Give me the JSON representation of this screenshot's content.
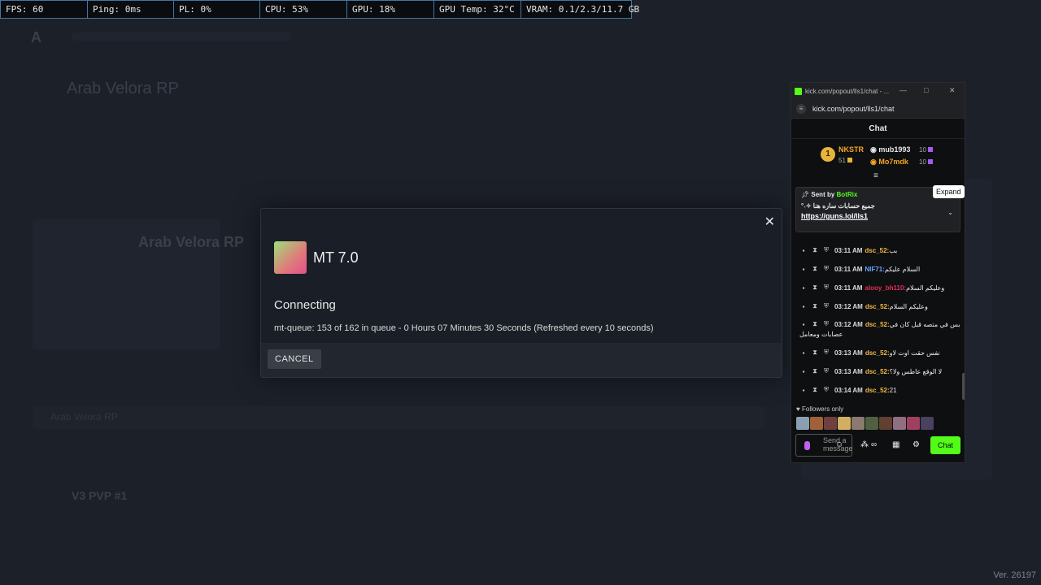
{
  "perf": {
    "fps": "FPS: 60",
    "ping": "Ping: 0ms",
    "pl": "PL: 0%",
    "cpu": "CPU: 53%",
    "gpu": "GPU: 18%",
    "gpu_temp": "GPU Temp: 32°C",
    "vram": "VRAM: 0.1/2.3/11.7 GB"
  },
  "background": {
    "server_name": "Arab Velora RP",
    "server_small": "Arab Velora RP",
    "server_row": "V3 PVP #1",
    "version": "Ver. 26197"
  },
  "modal": {
    "title": "MT 7.0",
    "status": "Connecting",
    "queue_text": "mt-queue: 153 of 162 in queue - 0 Hours 07 Minutes 30 Seconds (Refreshed every 10 seconds)",
    "cancel_label": "CANCEL",
    "close_glyph": "✕"
  },
  "chat": {
    "window_title": "kick.com/popout/lls1/chat - ...",
    "url": "kick.com/popout/lls1/chat",
    "header": "Chat",
    "leaderboard": {
      "first_name": "NKSTR",
      "first_value": "51",
      "first_rank": "1",
      "second_name": "mub1993",
      "second_value": "10",
      "third_name": "Mo7mdk",
      "third_value": "10"
    },
    "pinned": {
      "sent_by": "Sent by",
      "bot": "BotRix",
      "message": "جميع حسابات ساره هنا ✧˖°",
      "link": "https://guns.lol/lls1",
      "expand_tooltip": "Expand"
    },
    "messages": [
      {
        "time": "03:11 AM",
        "user": "dsc_52:",
        "text": "بب",
        "color": "#f2b84b"
      },
      {
        "time": "03:11 AM",
        "user": "NIF71:",
        "text": "السلام عليكم",
        "color": "#6aa6ff"
      },
      {
        "time": "03:11 AM",
        "user": "alooy_bh110:",
        "text": "وعليكم السلام",
        "color": "#e0305a"
      },
      {
        "time": "03:12 AM",
        "user": "dsc_52:",
        "text": "وعليكم السلام",
        "color": "#f2b84b"
      },
      {
        "time": "03:12 AM",
        "user": "dsc_52:",
        "text": "بس في متصه قبل كان في",
        "color": "#f2b84b"
      },
      {
        "time": "03:13 AM",
        "user": "dsc_52:",
        "text": "نفس حقت اوت لاو",
        "color": "#f2b84b"
      },
      {
        "time": "03:13 AM",
        "user": "dsc_52:",
        "text": "لا الوقع عاطس ولا؟",
        "color": "#f2b84b"
      },
      {
        "time": "03:14 AM",
        "user": "dsc_52:",
        "text": "21",
        "color": "#f2b84b"
      }
    ],
    "wrap_line": "عصابات ومعامل",
    "followers_only": "Followers only",
    "input_placeholder": "Send a message",
    "send_label": "Chat",
    "infinity": "∞"
  }
}
